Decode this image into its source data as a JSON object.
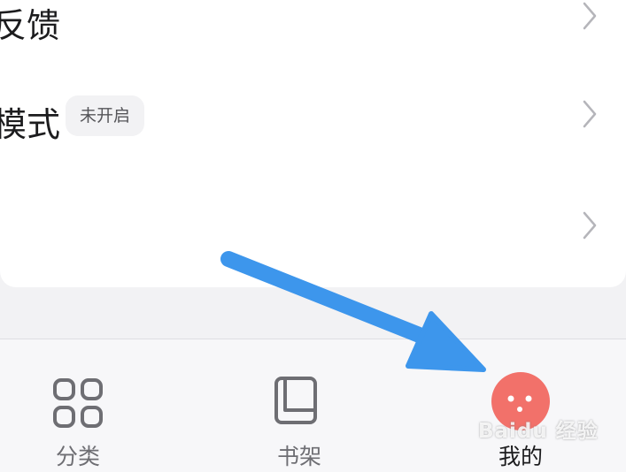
{
  "settings": {
    "rows": [
      {
        "label": "反馈"
      },
      {
        "label": "模式",
        "badge": "未开启"
      },
      {
        "label": ""
      }
    ]
  },
  "bottom_nav": {
    "items": [
      {
        "label": "分类",
        "icon": "grid-icon"
      },
      {
        "label": "书架",
        "icon": "bookshelf-icon"
      },
      {
        "label": "我的",
        "icon": "avatar-icon",
        "active": true
      }
    ]
  },
  "watermark": {
    "text": "Baidu 经验"
  },
  "colors": {
    "arrow": "#3d96ec",
    "avatar": "#f2716a",
    "active_text": "#1c1c1e",
    "inactive_text": "#6e6e73"
  }
}
